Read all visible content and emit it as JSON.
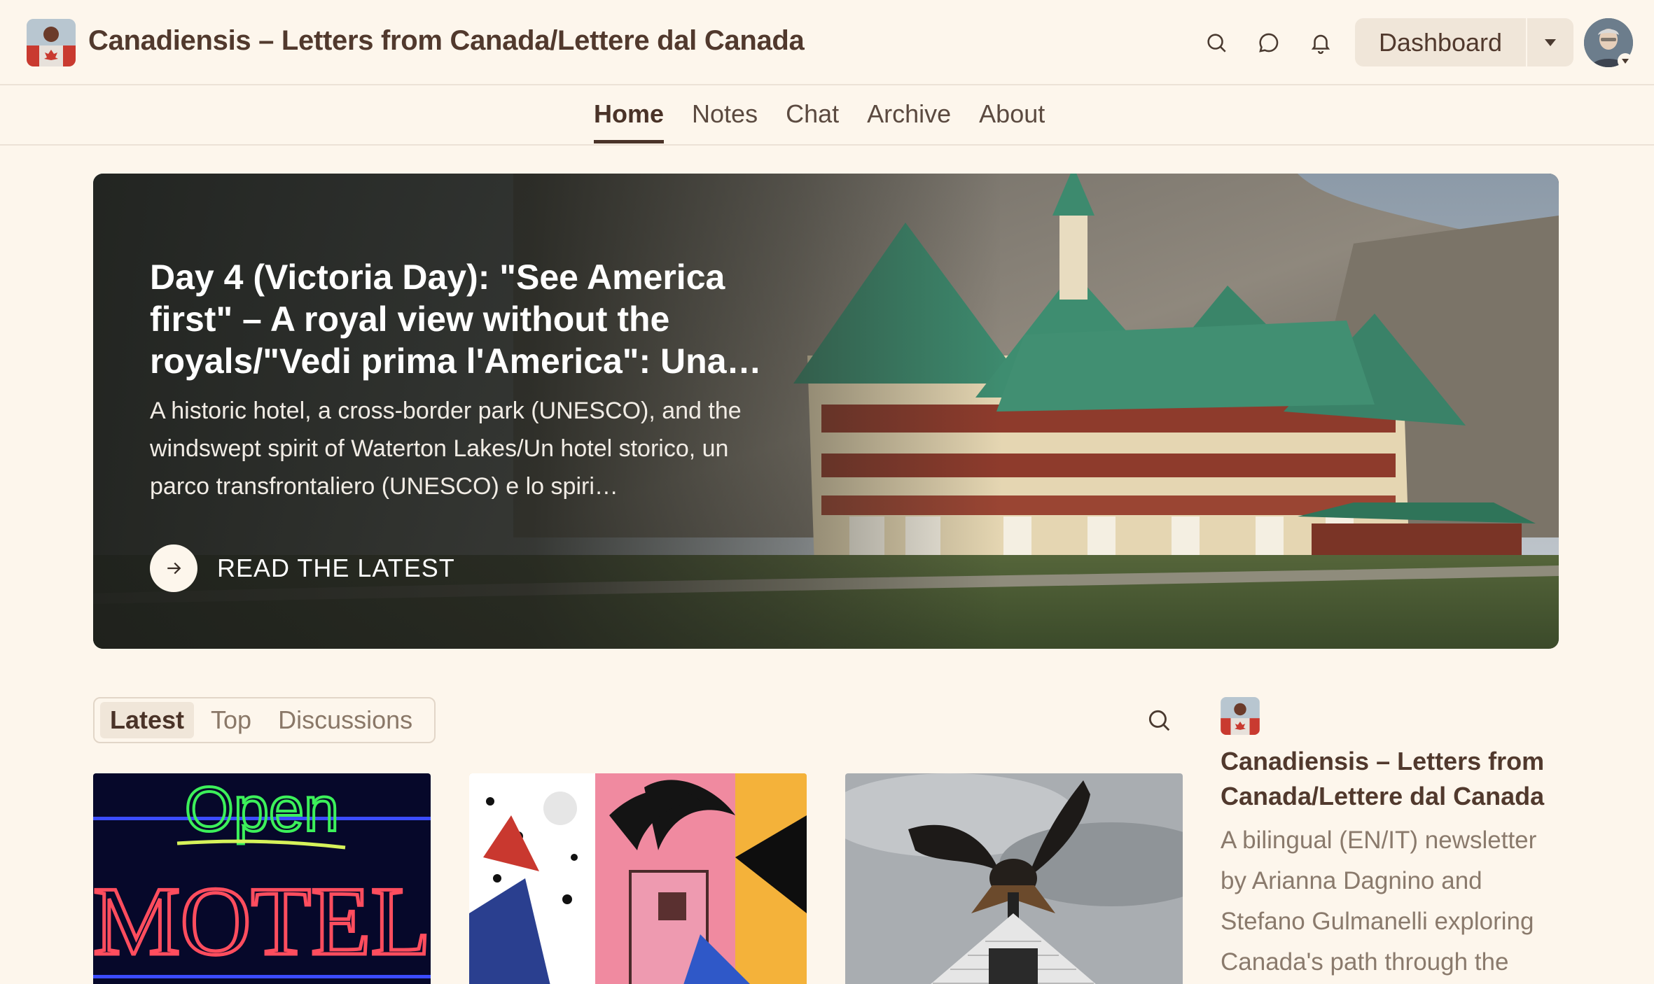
{
  "header": {
    "site_title": "Canadiensis – Letters from Canada/Lettere dal Canada",
    "dashboard_label": "Dashboard",
    "icons": [
      "search-icon",
      "chat-bubble-icon",
      "bell-icon",
      "caret-down-icon"
    ]
  },
  "nav": {
    "items": [
      {
        "label": "Home",
        "active": true
      },
      {
        "label": "Notes"
      },
      {
        "label": "Chat"
      },
      {
        "label": "Archive"
      },
      {
        "label": "About"
      }
    ]
  },
  "hero": {
    "title": "Day 4 (Victoria Day): \"See America first\" – A royal view without the royals/\"Vedi prima l'America\": Una…",
    "subtitle": "A historic hotel, a cross-border park (UNESCO), and the windswept spirit of Waterton Lakes/Un hotel storico, un parco transfrontaliero (UNESCO) e lo spiri…",
    "cta_label": "READ THE LATEST"
  },
  "feed": {
    "tabs": [
      {
        "label": "Latest",
        "active": true
      },
      {
        "label": "Top"
      },
      {
        "label": "Discussions"
      }
    ],
    "cards": [
      {
        "sign_top": "Open",
        "sign_bottom": "MOTEL"
      },
      {},
      {}
    ]
  },
  "sidebar": {
    "title": "Canadiensis – Letters from Canada/Lettere dal Canada",
    "description": "A bilingual (EN/IT) newsletter by Arianna Dagnino and Stefano Gulmanelli exploring Canada's path through the"
  },
  "colors": {
    "background": "#fdf6ec",
    "text": "#4a3a30",
    "muted": "#8a7a6c",
    "chip": "#f0e6d9",
    "roof_green": "#3d8a6e"
  }
}
